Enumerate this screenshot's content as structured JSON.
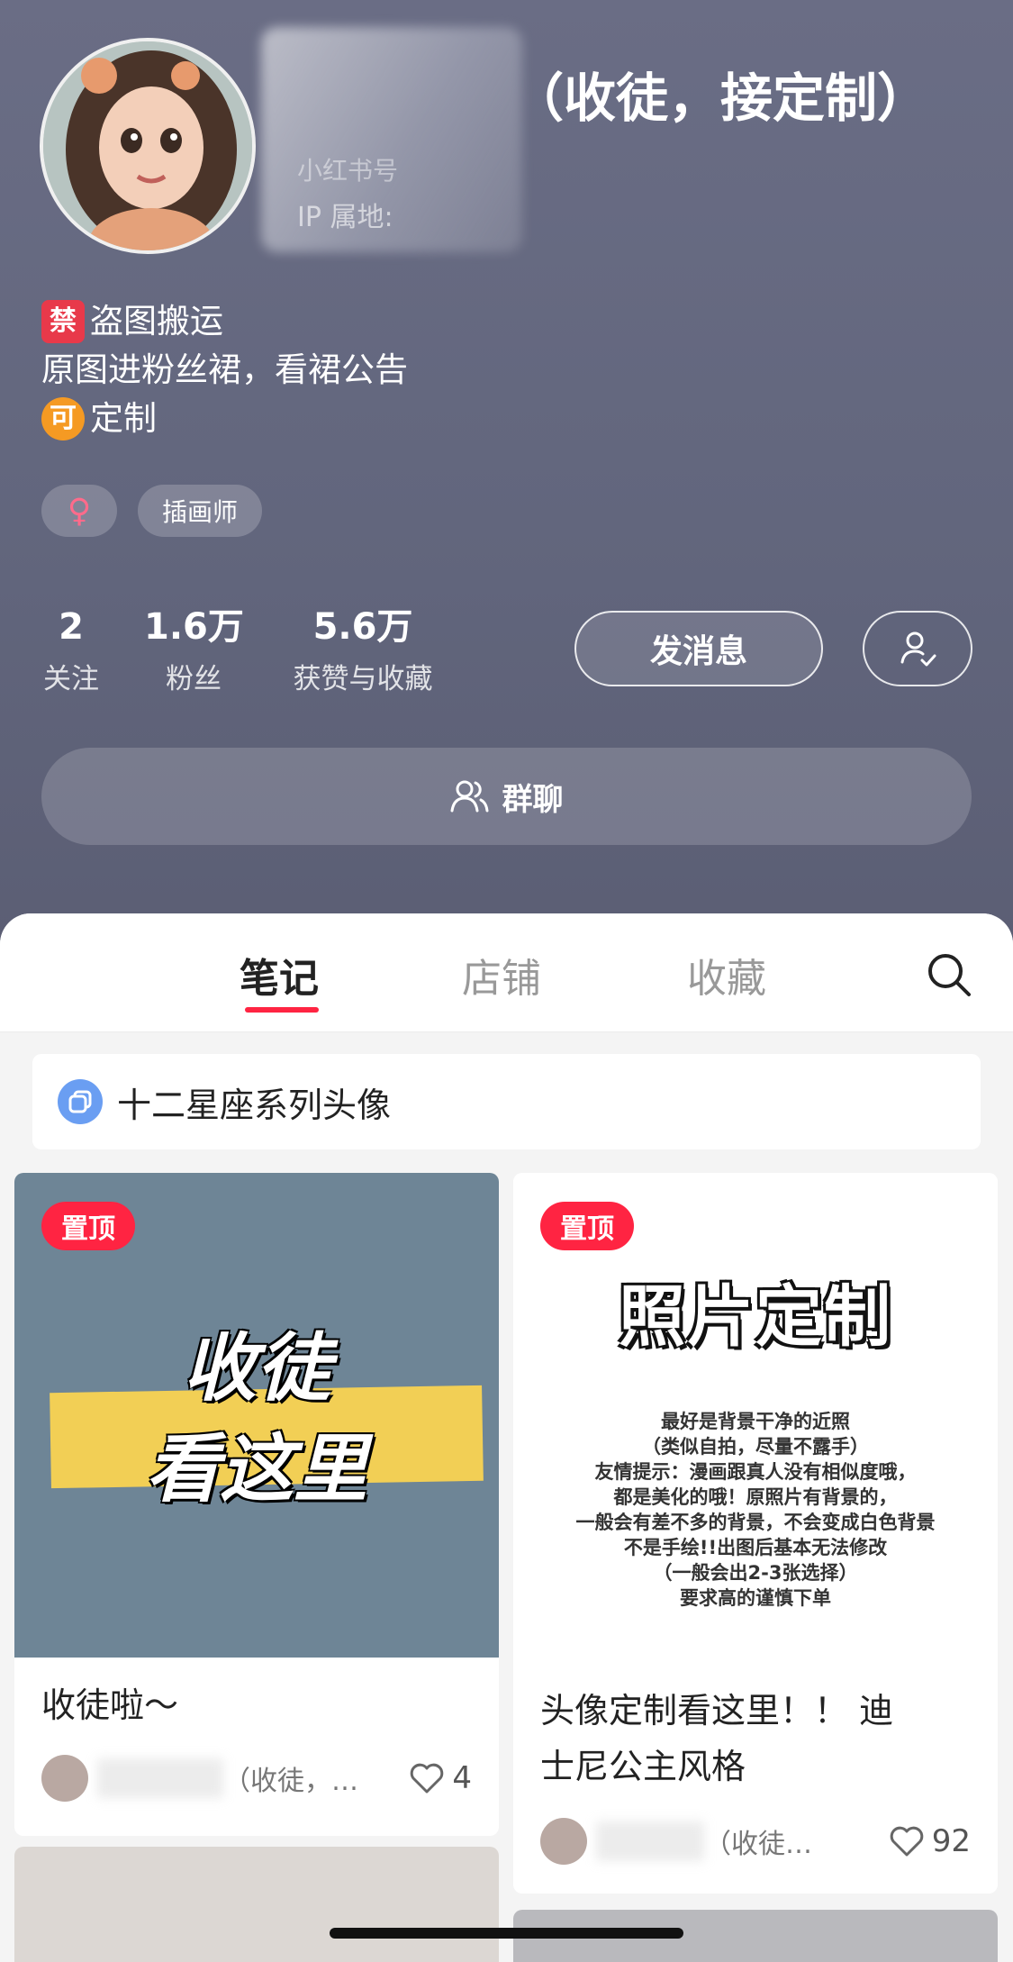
{
  "profile": {
    "username": "（收徒，接定制）",
    "red_id": "小红书号",
    "ip": "IP 属地:",
    "bio": [
      {
        "icon": "禁",
        "text": "盗图搬运"
      },
      {
        "icon": "",
        "text": "原图进粉丝裙，看裙公告"
      },
      {
        "icon": "可",
        "text": "定制"
      }
    ],
    "tags": {
      "gender": "♀",
      "role": "插画师"
    }
  },
  "stats": [
    {
      "value": "2",
      "label": "关注"
    },
    {
      "value": "1.6万",
      "label": "粉丝"
    },
    {
      "value": "5.6万",
      "label": "获赞与收藏"
    }
  ],
  "actions": {
    "message": "发消息",
    "group_chat": "群聊"
  },
  "tabs": [
    {
      "label": "笔记",
      "active": true
    },
    {
      "label": "店铺",
      "active": false
    },
    {
      "label": "收藏",
      "active": false
    }
  ],
  "collection": {
    "title": "十二星座系列头像"
  },
  "notes": [
    {
      "pinned": "置顶",
      "cover_line1": "收徒",
      "cover_line2": "看这里",
      "title": "收徒啦～",
      "author": "（收徒，…",
      "likes": "4"
    },
    {
      "pinned": "置顶",
      "cover_title": "照片定制",
      "cover_text": [
        "最好是背景干净的近照",
        "（类似自拍，尽量不露手）",
        "友情提示：漫画跟真人没有相似度哦，",
        "都是美化的哦！原照片有背景的，",
        "一般会有差不多的背景，不会变成白色背景",
        "不是手绘!!出图后基本无法修改",
        "（一般会出2-3张选择）",
        "要求高的谨慎下单"
      ],
      "title_line1": "头像定制看这里！！ 迪",
      "title_line2": "士尼公主风格",
      "author": "（收徒…",
      "likes": "92"
    }
  ],
  "icons": {
    "follow": "user-check-icon",
    "group": "group-icon",
    "search": "search-icon",
    "collection": "collection-icon",
    "like": "heart-icon"
  },
  "colors": {
    "accent": "#ff2442",
    "header": "#63667d",
    "tag_highlight": "#f2cf55"
  }
}
